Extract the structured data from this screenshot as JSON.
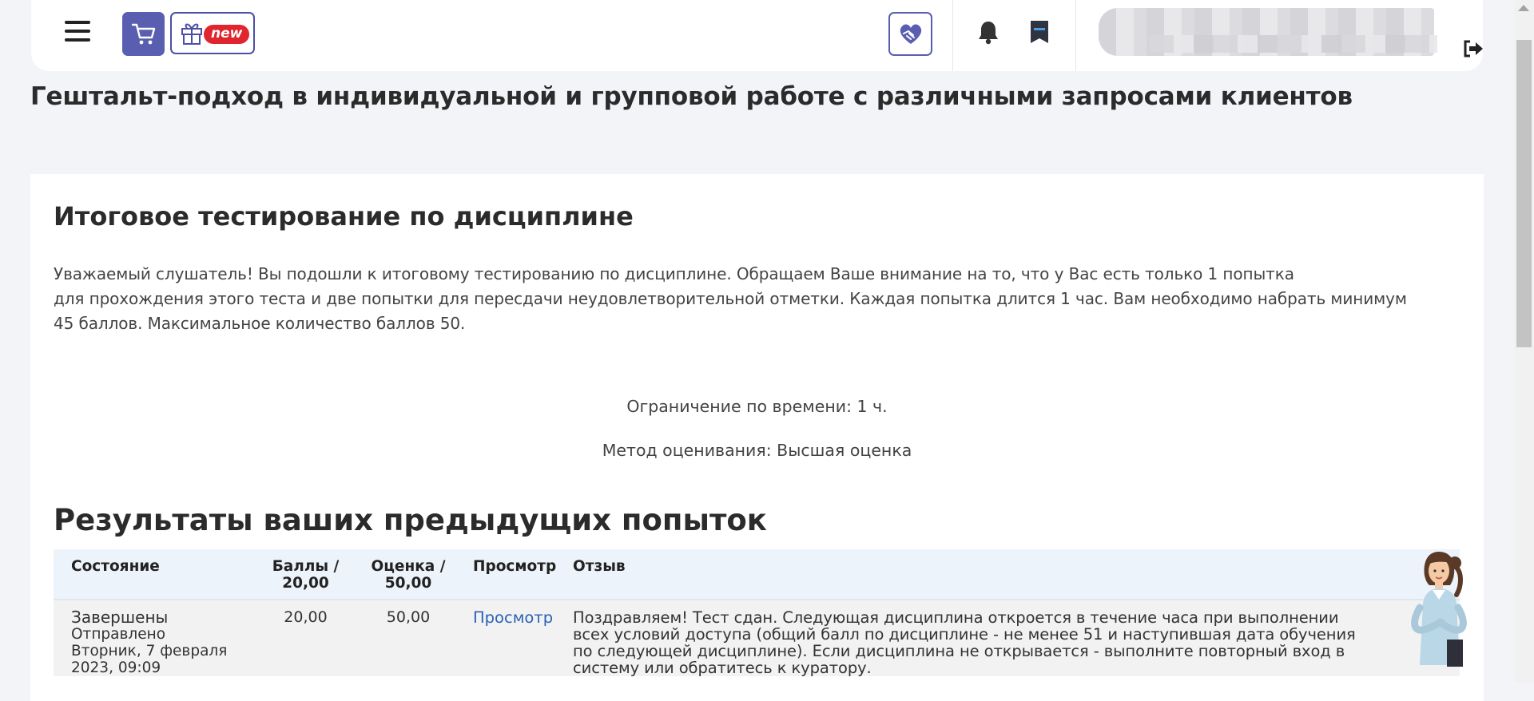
{
  "navbar": {
    "menu_icon": "hamburger-menu-icon",
    "cart_icon": "shopping-cart-icon",
    "gift_icon": "gift-icon",
    "gift_badge": "new",
    "partner_icon": "handshake-heart-icon",
    "notifications_icon": "bell-icon",
    "messages_icon": "message-icon",
    "logout_icon": "logout-icon",
    "accent_color": "#5a5eb0",
    "badge_color": "#e0252f"
  },
  "course": {
    "title": "Гештальт-подход в индивидуальной и групповой работе с различными запросами клиентов"
  },
  "quiz": {
    "title": "Итоговое тестирование по дисциплине",
    "intro_lines": [
      "Уважаемый слушатель! Вы подошли к итоговому тестированию по дисциплине. Обращаем Ваше внимание на то, что у Вас есть только 1 попытка",
      "для прохождения этого теста и две попытки для пересдачи неудовлетворительной отметки. Каждая попытка длится 1 час. Вам необходимо набрать минимум",
      "45 баллов. Максимальное количество баллов 50."
    ],
    "time_limit": "Ограничение по времени: 1 ч.",
    "grading_method": "Метод оценивания: Высшая оценка"
  },
  "results": {
    "title": "Результаты ваших предыдущих попыток",
    "headers": {
      "state": "Состояние",
      "score_line1": "Баллы /",
      "score_line2": "20,00",
      "grade_line1": "Оценка /",
      "grade_line2": "50,00",
      "review": "Просмотр",
      "feedback": "Отзыв"
    },
    "rows": [
      {
        "state": "Завершены",
        "submitted": "Отправлено",
        "date_line1": "Вторник, 7 февраля",
        "date_line2": "2023, 09:09",
        "score": "20,00",
        "grade": "50,00",
        "review_link": "Просмотр",
        "feedback_lines": [
          "Поздравляем! Тест сдан. Следующая дисциплина откроется в течение часа при выполнении",
          "всех условий доступа (общий балл по дисциплине - не менее 51 и наступившая дата обучения",
          "по следующей дисциплине). Если дисциплина не открывается - выполните повторный вход в",
          "систему или обратитесь к куратору."
        ]
      }
    ]
  },
  "assistant_icon": "assistant-avatar-icon"
}
